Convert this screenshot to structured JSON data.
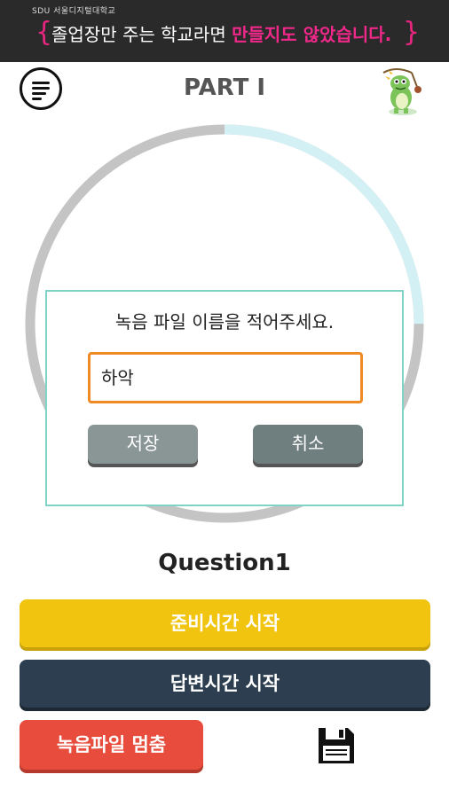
{
  "banner": {
    "brand": "SDU 서울디지털대학교",
    "message": "졸업장만 주는 학교라면",
    "highlight": "만들지도 않았습니다.",
    "brace_left": "{",
    "brace_right": "}"
  },
  "header": {
    "title": "PART Ⅰ"
  },
  "timer": {
    "progress": 0.25
  },
  "dialog": {
    "prompt": "녹음 파일 이름을 적어주세요.",
    "filename_value": "하악",
    "save_label": "저장",
    "cancel_label": "취소"
  },
  "question": {
    "label": "Question1"
  },
  "buttons": {
    "prep_label": "준비시간 시작",
    "answer_label": "답변시간 시작",
    "stop_label": "녹음파일 멈춤"
  },
  "colors": {
    "banner_bg": "#2a2a2a",
    "highlight_pink": "#f0288a",
    "ring_gray": "#c4c4c4",
    "ring_light_blue": "#d3f1f5",
    "dialog_border": "#7fd3c7",
    "input_border": "#f08a24",
    "prep_yellow": "#f1c40f",
    "answer_navy": "#2c3e50",
    "stop_red": "#e74c3c"
  },
  "icons": {
    "menu": "menu-icon",
    "mascot": "dinosaur-mascot-icon",
    "save": "floppy-disk-icon"
  }
}
